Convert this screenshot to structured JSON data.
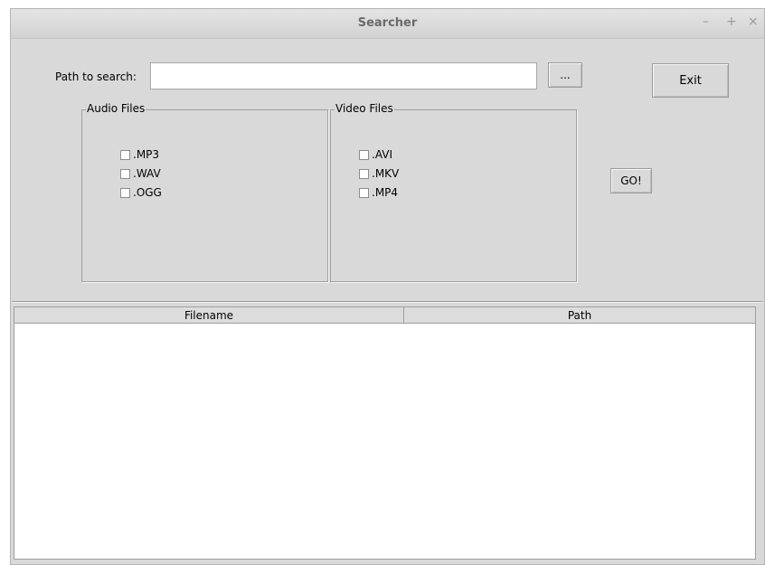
{
  "window": {
    "title": "Searcher",
    "controls": {
      "minimize": "–",
      "maximize": "+",
      "close": "×"
    }
  },
  "search": {
    "path_label": "Path to search:",
    "path_value": "",
    "browse_label": "...",
    "exit_label": "Exit",
    "go_label": "GO!"
  },
  "audio": {
    "title": "Audio Files",
    "options": [
      {
        "label": ".MP3",
        "checked": false
      },
      {
        "label": ".WAV",
        "checked": false
      },
      {
        "label": ".OGG",
        "checked": false
      }
    ]
  },
  "video": {
    "title": "Video Files",
    "options": [
      {
        "label": ".AVI",
        "checked": false
      },
      {
        "label": ".MKV",
        "checked": false
      },
      {
        "label": ".MP4",
        "checked": false
      }
    ]
  },
  "results": {
    "columns": [
      "Filename",
      "Path"
    ],
    "rows": []
  }
}
